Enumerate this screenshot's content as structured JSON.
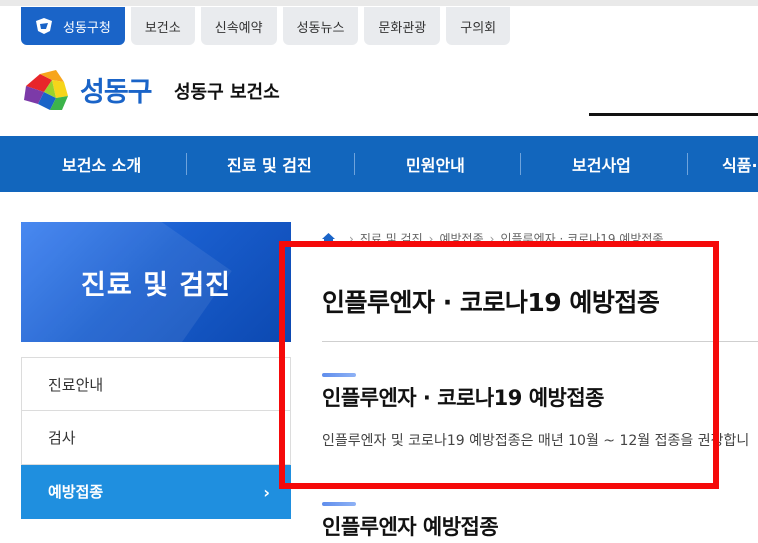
{
  "top_tabs": [
    {
      "label": "성동구청",
      "active": true,
      "icon": "district-logo-icon"
    },
    {
      "label": "보건소",
      "active": false
    },
    {
      "label": "신속예약",
      "active": false
    },
    {
      "label": "성동뉴스",
      "active": false
    },
    {
      "label": "문화관광",
      "active": false
    },
    {
      "label": "구의회",
      "active": false
    }
  ],
  "header": {
    "logo_text": "성동구",
    "site_name": "성동구 보건소"
  },
  "gnb": [
    {
      "label": "보건소 소개"
    },
    {
      "label": "진료 및 검진"
    },
    {
      "label": "민원안내"
    },
    {
      "label": "보건사업"
    },
    {
      "label": "식품·"
    }
  ],
  "lnb": {
    "title": "진료 및 검진",
    "items": [
      {
        "label": "진료안내",
        "active": false
      },
      {
        "label": "검사",
        "active": false
      },
      {
        "label": "예방접종",
        "active": true
      }
    ]
  },
  "breadcrumb": {
    "items": [
      "진료 및 검진",
      "예방접종",
      "인플루엔자 · 코로나19 예방접종"
    ],
    "separator": "›"
  },
  "content": {
    "page_title": "인플루엔자 · 코로나19 예방접종",
    "section1_title": "인플루엔자 · 코로나19 예방접종",
    "section1_desc": "인플루엔자 및 코로나19 예방접종은 매년 10월 ~ 12월 접종을 권장합니",
    "section2_title": "인플루엔자 예방접종"
  },
  "colors": {
    "brand_blue": "#1a64c8",
    "nav_blue": "#1266bd",
    "active_item": "#1f8fdf",
    "highlight_red": "#f50a0a"
  }
}
